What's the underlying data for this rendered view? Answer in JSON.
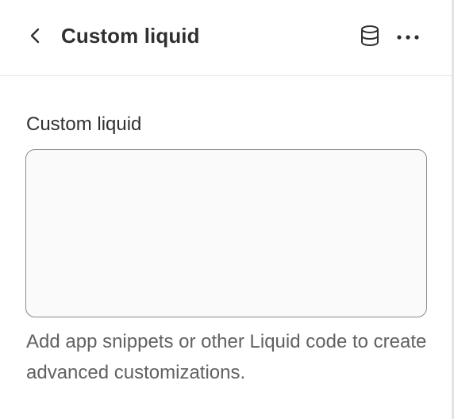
{
  "header": {
    "title": "Custom liquid",
    "back_icon": "chevron-left-icon",
    "data_icon": "database-icon",
    "more_icon": "more-horizontal-icon"
  },
  "field": {
    "label": "Custom liquid",
    "value": "",
    "placeholder": "",
    "help_text": "Add app snippets or other Liquid code to create advanced customizations."
  },
  "colors": {
    "text": "#303030",
    "muted_text": "#616161",
    "border": "#8a8a8a",
    "divider": "#e3e3e3",
    "field_bg": "#fafafa"
  }
}
